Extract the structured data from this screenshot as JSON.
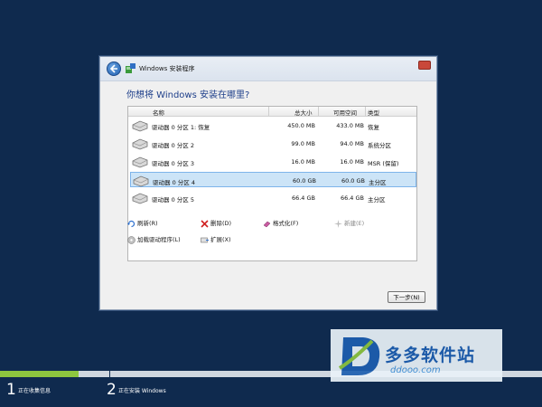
{
  "window": {
    "title": "Windows 安装程序",
    "heading": "你想将 Windows 安装在哪里?"
  },
  "table": {
    "headers": {
      "name": "名称",
      "total": "总大小",
      "free": "可用空间",
      "type": "类型"
    },
    "rows": [
      {
        "name": "驱动器 0 分区 1: 恢复",
        "total": "450.0 MB",
        "free": "433.0 MB",
        "type": "恢复"
      },
      {
        "name": "驱动器 0 分区 2",
        "total": "99.0 MB",
        "free": "94.0 MB",
        "type": "系统分区"
      },
      {
        "name": "驱动器 0 分区 3",
        "total": "16.0 MB",
        "free": "16.0 MB",
        "type": "MSR (保留)"
      },
      {
        "name": "驱动器 0 分区 4",
        "total": "60.0 GB",
        "free": "60.0 GB",
        "type": "主分区",
        "selected": true
      },
      {
        "name": "驱动器 0 分区 5",
        "total": "66.4 GB",
        "free": "66.4 GB",
        "type": "主分区"
      }
    ]
  },
  "actions": {
    "refresh": "刷新(R)",
    "delete": "删除(D)",
    "format": "格式化(F)",
    "new": "新建(E)",
    "load_driver": "加载驱动程序(L)",
    "extend": "扩展(X)"
  },
  "next_button": "下一步(N)",
  "progress": {
    "fraction": 0.145,
    "steps": [
      {
        "number": "1",
        "label": "正在收集信息"
      },
      {
        "number": "2",
        "label": "正在安装 Windows"
      }
    ]
  },
  "watermark": {
    "name": "多多软件站",
    "url": "ddooo.com"
  },
  "colors": {
    "background": "#0f2a4e",
    "progress": "#8dc63f",
    "heading": "#1e3f8a",
    "selection": "#cce4f7"
  }
}
